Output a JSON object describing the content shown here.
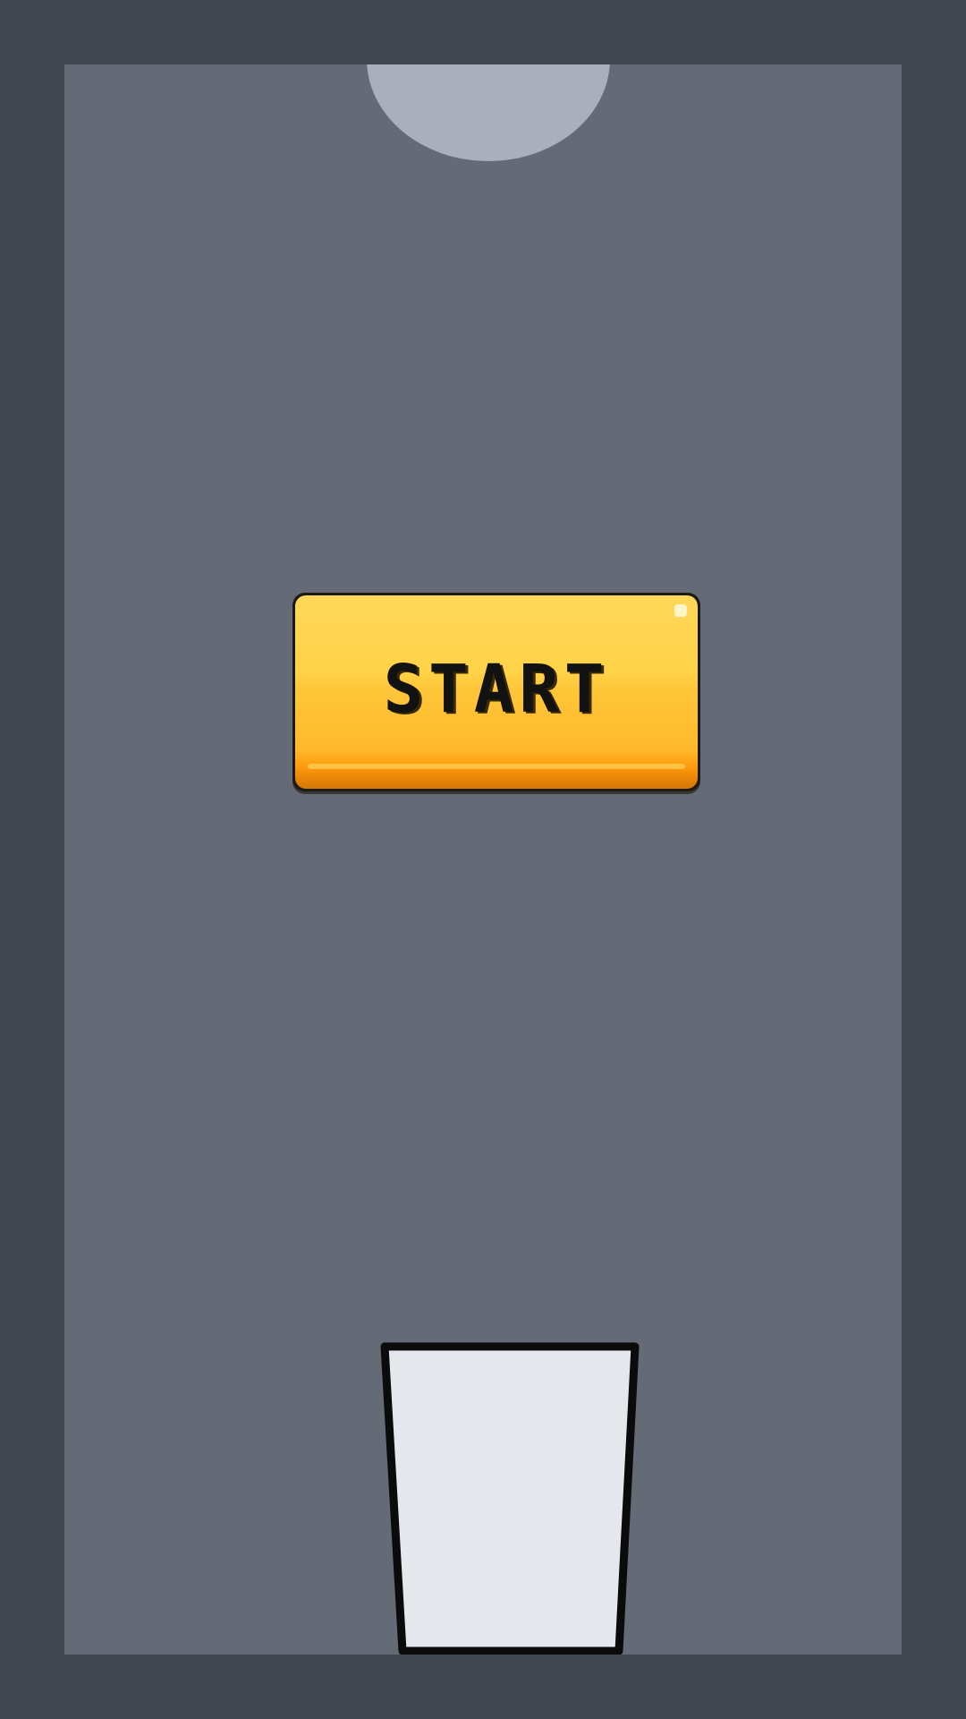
{
  "game": {
    "start_button_label": "START"
  },
  "colors": {
    "outer_background": "#414751",
    "playfield_background": "#646a76",
    "dispenser": "#a9afbc",
    "button_top": "#ffd85a",
    "button_bottom": "#ff9d10",
    "button_text": "#121212",
    "cup_fill": "#e4e7ec",
    "cup_outline": "#0b0b0b"
  },
  "icons": {
    "dispenser": "ball-dispenser-icon",
    "cup": "cup-icon"
  }
}
